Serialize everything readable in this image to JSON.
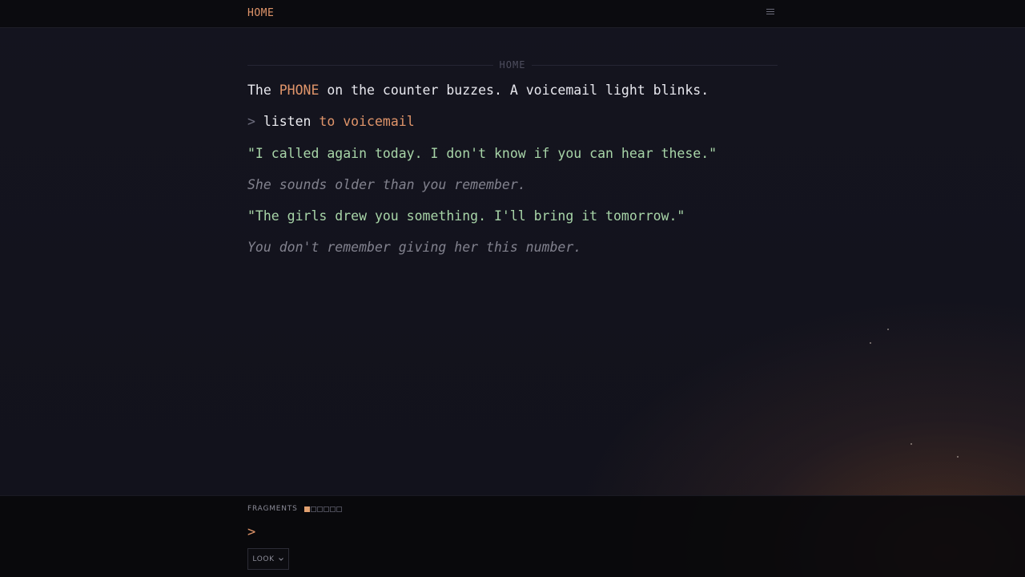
{
  "header": {
    "location": "HOME",
    "menu_icon": "menu-icon"
  },
  "section": {
    "label": "HOME"
  },
  "story": {
    "line1": {
      "before": "The ",
      "highlight": "PHONE",
      "after": " on the counter buzzes. A voicemail light blinks."
    },
    "command": {
      "prompt": ">",
      "verb": "listen",
      "object": "to voicemail"
    },
    "dialogue1": "\"I called again today. I don't know if you can hear these.\"",
    "aside1": "She sounds older than you remember.",
    "dialogue2": "\"The girls drew you something. I'll bring it tomorrow.\"",
    "aside2": "You don't remember giving her this number."
  },
  "footer": {
    "fragments_label": "FRAGMENTS",
    "fragments_collected": 1,
    "fragments_total": 6,
    "input_prompt": ">",
    "look_label": "LOOK"
  },
  "colors": {
    "accent": "#e0956a",
    "dialogue": "#a8d5a8",
    "aside": "#82828e",
    "background": "#12121c"
  }
}
